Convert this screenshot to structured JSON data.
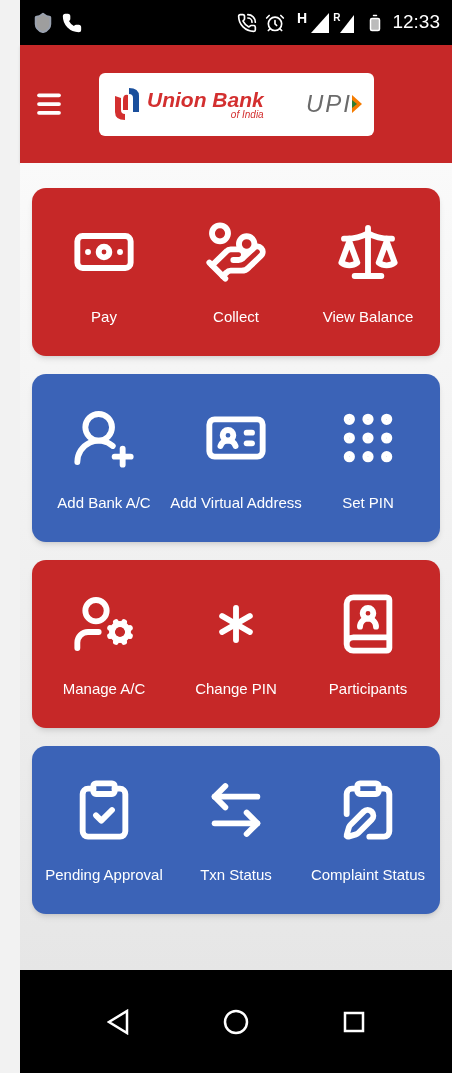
{
  "status_bar": {
    "network_type": "H",
    "roaming": "R",
    "time": "12:33"
  },
  "header": {
    "logo": {
      "bank_name": "Union Bank",
      "bank_suffix": "of India",
      "upi": "UPI"
    }
  },
  "cards": [
    {
      "color": "#c62828",
      "items": [
        {
          "label": "Pay"
        },
        {
          "label": "Collect"
        },
        {
          "label": "View Balance"
        }
      ]
    },
    {
      "color": "#3b63b7",
      "items": [
        {
          "label": "Add Bank A/C"
        },
        {
          "label": "Add Virtual Address"
        },
        {
          "label": "Set PIN"
        }
      ]
    },
    {
      "color": "#c62828",
      "items": [
        {
          "label": "Manage A/C"
        },
        {
          "label": "Change PIN"
        },
        {
          "label": "Participants"
        }
      ]
    },
    {
      "color": "#3b63b7",
      "items": [
        {
          "label": "Pending Approval"
        },
        {
          "label": "Txn Status"
        },
        {
          "label": "Complaint Status"
        }
      ]
    }
  ]
}
